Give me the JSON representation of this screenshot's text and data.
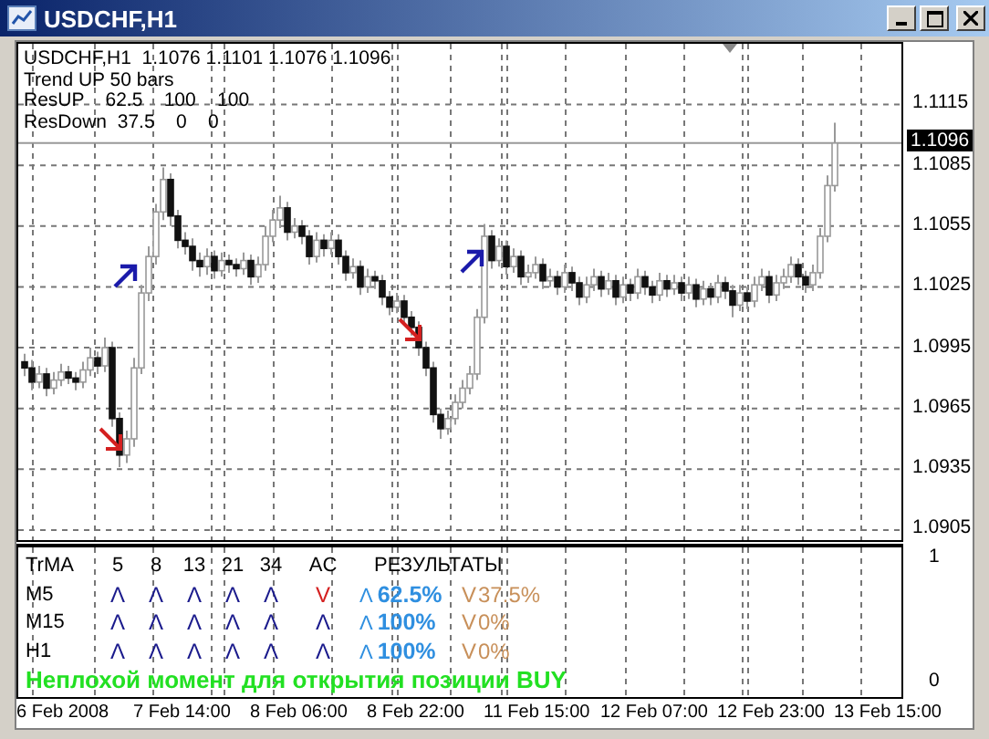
{
  "window": {
    "title": "USDCHF,H1"
  },
  "chart": {
    "info_lines": [
      "USDCHF,H1  1.1076 1.1101 1.1076 1.1096",
      "Trend UP 50 bars",
      "ResUP    62.5    100    100",
      "ResDown  37.5    0    0"
    ],
    "chart_data": {
      "type": "candlestick",
      "ohlc": [
        [
          1.0988,
          1.0992,
          1.0981,
          1.0985
        ],
        [
          1.0985,
          1.0989,
          1.0974,
          1.0978
        ],
        [
          1.0978,
          1.0986,
          1.0975,
          1.0982
        ],
        [
          1.0982,
          1.0985,
          1.0971,
          1.0975
        ],
        [
          1.0975,
          1.0983,
          1.0972,
          1.0979
        ],
        [
          1.0979,
          1.0987,
          1.0976,
          1.0983
        ],
        [
          1.0983,
          1.0986,
          1.0977,
          1.098
        ],
        [
          1.098,
          1.0983,
          1.0974,
          1.0978
        ],
        [
          1.0978,
          1.0988,
          1.0975,
          1.0984
        ],
        [
          1.0984,
          1.0995,
          1.0981,
          1.099
        ],
        [
          1.099,
          1.0993,
          1.0982,
          1.0986
        ],
        [
          1.0986,
          1.1,
          1.0983,
          1.0995
        ],
        [
          1.0995,
          1.0998,
          1.0956,
          1.096
        ],
        [
          1.096,
          1.0963,
          1.0936,
          1.0942
        ],
        [
          1.0942,
          1.0954,
          1.0938,
          1.095
        ],
        [
          1.095,
          1.099,
          1.0946,
          1.0985
        ],
        [
          1.0985,
          1.1026,
          1.0982,
          1.1022
        ],
        [
          1.1022,
          1.1045,
          1.1018,
          1.104
        ],
        [
          1.104,
          1.1066,
          1.1036,
          1.1062
        ],
        [
          1.1062,
          1.1084,
          1.1058,
          1.1078
        ],
        [
          1.1078,
          1.1081,
          1.1055,
          1.106
        ],
        [
          1.106,
          1.1063,
          1.1044,
          1.1048
        ],
        [
          1.1048,
          1.1052,
          1.1041,
          1.1045
        ],
        [
          1.1045,
          1.1049,
          1.1033,
          1.1038
        ],
        [
          1.1038,
          1.1042,
          1.103,
          1.1035
        ],
        [
          1.1035,
          1.1044,
          1.1031,
          1.104
        ],
        [
          1.104,
          1.1043,
          1.1029,
          1.1033
        ],
        [
          1.1033,
          1.1042,
          1.103,
          1.1038
        ],
        [
          1.1038,
          1.1041,
          1.1032,
          1.1036
        ],
        [
          1.1036,
          1.1039,
          1.103,
          1.1034
        ],
        [
          1.1034,
          1.1042,
          1.1031,
          1.1038
        ],
        [
          1.1038,
          1.1041,
          1.1026,
          1.103
        ],
        [
          1.103,
          1.104,
          1.1027,
          1.1036
        ],
        [
          1.1036,
          1.1055,
          1.1033,
          1.105
        ],
        [
          1.105,
          1.1063,
          1.1047,
          1.1058
        ],
        [
          1.1058,
          1.107,
          1.1054,
          1.1064
        ],
        [
          1.1064,
          1.1067,
          1.1048,
          1.1052
        ],
        [
          1.1052,
          1.1059,
          1.1049,
          1.1055
        ],
        [
          1.1055,
          1.1058,
          1.1046,
          1.105
        ],
        [
          1.105,
          1.1053,
          1.1036,
          1.104
        ],
        [
          1.104,
          1.1052,
          1.1037,
          1.1048
        ],
        [
          1.1048,
          1.1051,
          1.104,
          1.1044
        ],
        [
          1.1044,
          1.1052,
          1.1041,
          1.1048
        ],
        [
          1.1048,
          1.1051,
          1.1036,
          1.104
        ],
        [
          1.104,
          1.1043,
          1.1028,
          1.1032
        ],
        [
          1.1032,
          1.1039,
          1.1029,
          1.1035
        ],
        [
          1.1035,
          1.1038,
          1.1021,
          1.1025
        ],
        [
          1.1025,
          1.1034,
          1.1022,
          1.103
        ],
        [
          1.103,
          1.1033,
          1.1024,
          1.1028
        ],
        [
          1.1028,
          1.1031,
          1.1016,
          1.102
        ],
        [
          1.102,
          1.1023,
          1.1011,
          1.1015
        ],
        [
          1.1015,
          1.1022,
          1.1012,
          1.1018
        ],
        [
          1.1018,
          1.1021,
          1.1006,
          1.101
        ],
        [
          1.101,
          1.1013,
          1.1001,
          1.1005
        ],
        [
          1.1005,
          1.1008,
          1.0991,
          1.0995
        ],
        [
          1.0995,
          1.0998,
          1.0981,
          1.0985
        ],
        [
          1.0985,
          1.0988,
          1.0958,
          1.0962
        ],
        [
          1.0962,
          1.0965,
          1.095,
          1.0955
        ],
        [
          1.0955,
          1.0964,
          1.0952,
          1.096
        ],
        [
          1.096,
          1.0972,
          1.0957,
          1.0968
        ],
        [
          1.0968,
          1.0979,
          1.0965,
          1.0975
        ],
        [
          1.0975,
          1.0986,
          1.0972,
          1.0982
        ],
        [
          1.0982,
          1.1014,
          1.0979,
          1.101
        ],
        [
          1.101,
          1.1056,
          1.1007,
          1.105
        ],
        [
          1.105,
          1.1053,
          1.1034,
          1.1038
        ],
        [
          1.1038,
          1.1049,
          1.1035,
          1.1045
        ],
        [
          1.1045,
          1.1048,
          1.1031,
          1.1035
        ],
        [
          1.1035,
          1.1044,
          1.1032,
          1.104
        ],
        [
          1.104,
          1.1043,
          1.1026,
          1.103
        ],
        [
          1.103,
          1.1036,
          1.1027,
          1.1032
        ],
        [
          1.1032,
          1.104,
          1.1029,
          1.1036
        ],
        [
          1.1036,
          1.1039,
          1.1024,
          1.1028
        ],
        [
          1.1028,
          1.1034,
          1.1025,
          1.103
        ],
        [
          1.103,
          1.1033,
          1.1021,
          1.1025
        ],
        [
          1.1025,
          1.1036,
          1.1022,
          1.1032
        ],
        [
          1.1032,
          1.1035,
          1.1023,
          1.1027
        ],
        [
          1.1027,
          1.103,
          1.1016,
          1.102
        ],
        [
          1.102,
          1.103,
          1.1017,
          1.1026
        ],
        [
          1.1026,
          1.1034,
          1.1023,
          1.103
        ],
        [
          1.103,
          1.1033,
          1.102,
          1.1024
        ],
        [
          1.1024,
          1.1032,
          1.1021,
          1.1028
        ],
        [
          1.1028,
          1.1031,
          1.1016,
          1.102
        ],
        [
          1.102,
          1.103,
          1.1017,
          1.1026
        ],
        [
          1.1026,
          1.1029,
          1.1018,
          1.1022
        ],
        [
          1.1022,
          1.1034,
          1.1019,
          1.103
        ],
        [
          1.103,
          1.1033,
          1.1021,
          1.1025
        ],
        [
          1.1025,
          1.1028,
          1.1017,
          1.1021
        ],
        [
          1.1021,
          1.1032,
          1.1018,
          1.1028
        ],
        [
          1.1028,
          1.1031,
          1.102,
          1.1024
        ],
        [
          1.1024,
          1.1031,
          1.1021,
          1.1027
        ],
        [
          1.1027,
          1.103,
          1.1018,
          1.1022
        ],
        [
          1.1022,
          1.103,
          1.1019,
          1.1026
        ],
        [
          1.1026,
          1.1029,
          1.1015,
          1.1019
        ],
        [
          1.1019,
          1.1028,
          1.1016,
          1.1024
        ],
        [
          1.1024,
          1.1027,
          1.1016,
          1.102
        ],
        [
          1.102,
          1.1031,
          1.1017,
          1.1027
        ],
        [
          1.1027,
          1.103,
          1.1019,
          1.1023
        ],
        [
          1.1023,
          1.1026,
          1.101,
          1.1016
        ],
        [
          1.1016,
          1.1026,
          1.1013,
          1.1022
        ],
        [
          1.1022,
          1.1025,
          1.1014,
          1.1018
        ],
        [
          1.1018,
          1.103,
          1.1015,
          1.1026
        ],
        [
          1.1026,
          1.1034,
          1.1023,
          1.103
        ],
        [
          1.103,
          1.1033,
          1.1017,
          1.1021
        ],
        [
          1.1021,
          1.1031,
          1.1018,
          1.1027
        ],
        [
          1.1027,
          1.1034,
          1.1024,
          1.103
        ],
        [
          1.103,
          1.104,
          1.1027,
          1.1036
        ],
        [
          1.1036,
          1.1039,
          1.1026,
          1.103
        ],
        [
          1.103,
          1.1033,
          1.1022,
          1.1026
        ],
        [
          1.1026,
          1.1036,
          1.1023,
          1.1032
        ],
        [
          1.1032,
          1.1054,
          1.1029,
          1.105
        ],
        [
          1.105,
          1.108,
          1.1047,
          1.1075
        ],
        [
          1.1075,
          1.1106,
          1.1072,
          1.1096
        ]
      ],
      "ylim": [
        1.09,
        1.1145
      ],
      "yticks": [
        {
          "value": 1.1115,
          "label": "1.1115"
        },
        {
          "value": 1.1085,
          "label": "1.1085"
        },
        {
          "value": 1.1055,
          "label": "1.1055"
        },
        {
          "value": 1.1025,
          "label": "1.1025"
        },
        {
          "value": 1.0995,
          "label": "1.0995"
        },
        {
          "value": 1.0965,
          "label": "1.0965"
        },
        {
          "value": 1.0935,
          "label": "1.0935"
        },
        {
          "value": 1.0905,
          "label": "1.0905"
        }
      ],
      "grid": true,
      "ref_lines": [
        {
          "axis": "y",
          "value": 1.1096,
          "label": "1.1096"
        }
      ]
    }
  },
  "indicator": {
    "columns": [
      "TrMA",
      "5",
      "8",
      "13",
      "21",
      "34",
      "AC",
      "РЕЗУЛЬТАТЫ"
    ],
    "rows": [
      {
        "label": "M5",
        "signals": [
          {
            "text": "Λ",
            "kind": "up"
          },
          {
            "text": "Λ",
            "kind": "up"
          },
          {
            "text": "Λ",
            "kind": "up"
          },
          {
            "text": "Λ",
            "kind": "up"
          },
          {
            "text": "Λ",
            "kind": "up"
          },
          {
            "text": "V",
            "kind": "down"
          }
        ],
        "up": {
          "mark": "Λ",
          "value": "62.5%"
        },
        "down": {
          "mark": "V",
          "value": "37.5%"
        }
      },
      {
        "label": "M15",
        "signals": [
          {
            "text": "Λ",
            "kind": "up"
          },
          {
            "text": "Λ",
            "kind": "up"
          },
          {
            "text": "Λ",
            "kind": "up"
          },
          {
            "text": "Λ",
            "kind": "up"
          },
          {
            "text": "Λ",
            "kind": "up"
          },
          {
            "text": "Λ",
            "kind": "up"
          }
        ],
        "up": {
          "mark": "Λ",
          "value": "100%"
        },
        "down": {
          "mark": "V",
          "value": "0%"
        }
      },
      {
        "label": "H1",
        "signals": [
          {
            "text": "Λ",
            "kind": "up"
          },
          {
            "text": "Λ",
            "kind": "up"
          },
          {
            "text": "Λ",
            "kind": "up"
          },
          {
            "text": "Λ",
            "kind": "up"
          },
          {
            "text": "Λ",
            "kind": "up"
          },
          {
            "text": "Λ",
            "kind": "up"
          }
        ],
        "up": {
          "mark": "Λ",
          "value": "100%"
        },
        "down": {
          "mark": "V",
          "value": "0%"
        }
      }
    ],
    "message": "Неплохой момент для открытия позиции BUY",
    "scale_labels": [
      "1",
      "0"
    ]
  },
  "time_labels": [
    "6 Feb 2008",
    "7 Feb 14:00",
    "8 Feb 06:00",
    "8 Feb 22:00",
    "11 Feb 15:00",
    "12 Feb 07:00",
    "12 Feb 23:00",
    "13 Feb 15:00"
  ]
}
